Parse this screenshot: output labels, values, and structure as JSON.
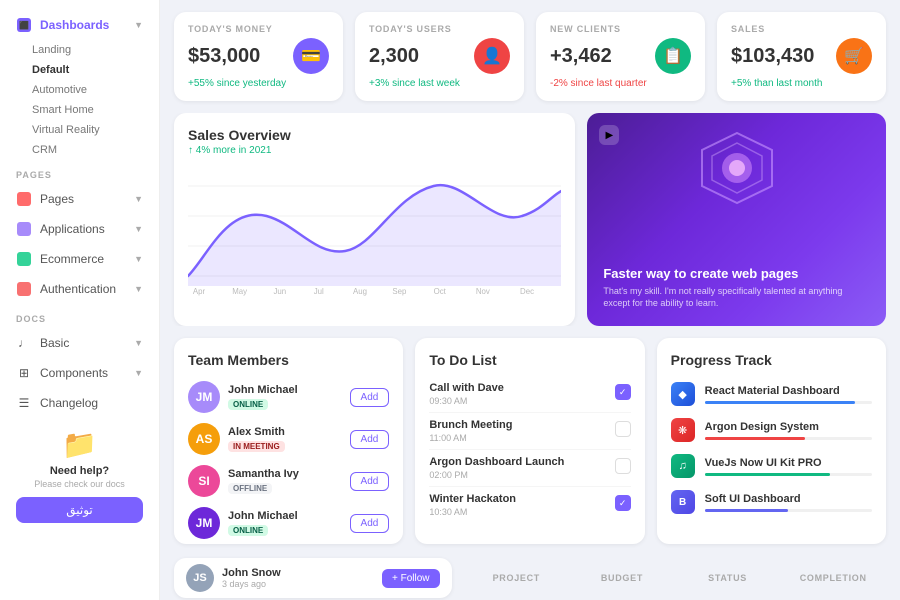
{
  "sidebar": {
    "dashboards_label": "Dashboards",
    "sub_landing": "Landing",
    "sub_default": "Default",
    "sub_automotive": "Automotive",
    "sub_smarthome": "Smart Home",
    "sub_virtualreality": "Virtual Reality",
    "sub_crm": "CRM",
    "section_pages": "PAGES",
    "item_pages": "Pages",
    "item_applications": "Applications",
    "item_ecommerce": "Ecommerce",
    "item_authentication": "Authentication",
    "section_docs": "DOCS",
    "item_basic": "Basic",
    "item_components": "Components",
    "item_changelog": "Changelog",
    "help_title": "Need help?",
    "help_text": "Please check our docs",
    "help_btn": "توثيق"
  },
  "stats": [
    {
      "label": "TODAY'S MONEY",
      "value": "$53,000",
      "change": "+55% since yesterday",
      "change_type": "pos",
      "icon": "💳"
    },
    {
      "label": "TODAY'S USERS",
      "value": "2,300",
      "change": "+3% since last week",
      "change_type": "pos",
      "icon": "👤"
    },
    {
      "label": "NEW CLIENTS",
      "value": "+3,462",
      "change": "-2% since last quarter",
      "change_type": "neg",
      "icon": "📋"
    },
    {
      "label": "SALES",
      "value": "$103,430",
      "change": "+5% than last month",
      "change_type": "pos",
      "icon": "🛒"
    }
  ],
  "sales_overview": {
    "title": "Sales Overview",
    "subtitle": "↑ 4% more in 2021",
    "chart_months": [
      "Apr",
      "May",
      "Jun",
      "Jul",
      "Aug",
      "Sep",
      "Oct",
      "Nov",
      "Dec"
    ]
  },
  "promo": {
    "title": "Faster way to create web pages",
    "desc": "That's my skill. I'm not really specifically talented at anything except for the ability to learn."
  },
  "team": {
    "title": "Team Members",
    "members": [
      {
        "name": "John Michael",
        "status": "ONLINE",
        "status_type": "online",
        "initials": "JM"
      },
      {
        "name": "Alex Smith",
        "status": "IN MEETING",
        "status_type": "meeting",
        "initials": "AS"
      },
      {
        "name": "Samantha Ivy",
        "status": "OFFLINE",
        "status_type": "offline",
        "initials": "SI"
      },
      {
        "name": "John Michael",
        "status": "ONLINE",
        "status_type": "online",
        "initials": "JM"
      }
    ],
    "add_label": "Add"
  },
  "todo": {
    "title": "To Do List",
    "items": [
      {
        "name": "Call with Dave",
        "time": "09:30 AM",
        "checked": true
      },
      {
        "name": "Brunch Meeting",
        "time": "11:00 AM",
        "checked": false
      },
      {
        "name": "Argon Dashboard Launch",
        "time": "02:00 PM",
        "checked": false
      },
      {
        "name": "Winter Hackaton",
        "time": "10:30 AM",
        "checked": true
      }
    ]
  },
  "progress": {
    "title": "Progress Track",
    "items": [
      {
        "name": "React Material Dashboard",
        "pct": 90,
        "color": "blue",
        "icon": "◆",
        "icon_type": "react"
      },
      {
        "name": "Argon Design System",
        "pct": 60,
        "color": "red",
        "icon": "❋",
        "icon_type": "argon"
      },
      {
        "name": "VueJs Now UI Kit PRO",
        "pct": 75,
        "color": "green",
        "icon": "♫",
        "icon_type": "vue"
      },
      {
        "name": "Soft UI Dashboard",
        "pct": 50,
        "color": "indigo",
        "icon": "B",
        "icon_type": "soft"
      }
    ]
  },
  "footer": {
    "name": "John Snow",
    "time": "3 days ago",
    "follow_label": "+ Follow",
    "cols": [
      "PROJECT",
      "BUDGET",
      "STATUS",
      "COMPLETION"
    ]
  }
}
